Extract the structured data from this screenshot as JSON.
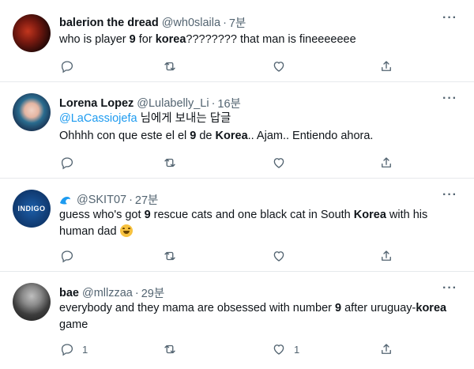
{
  "tweets": [
    {
      "name": "balerion the dread",
      "handle": "@wh0slaila",
      "time": "7분",
      "more": "···",
      "text_parts": [
        "who is player ",
        "9",
        " for ",
        "korea",
        "???????? that man is fineeeeeee"
      ],
      "reply_count": "",
      "retweet_count": "",
      "like_count": ""
    },
    {
      "name": "Lorena Lopez",
      "handle": "@Lulabelly_Li",
      "time": "16분",
      "more": "···",
      "reply_to_mention": "@LaCassiojefa",
      "reply_to_suffix": " 님에게 보내는 답글",
      "text_parts": [
        "Ohhhh con que este el el ",
        "9",
        " de ",
        "Korea",
        ".. Ajam.. Entiendo ahora."
      ],
      "reply_count": "",
      "retweet_count": "",
      "like_count": ""
    },
    {
      "name": "",
      "handle": "@SKIT07",
      "time": "27분",
      "more": "···",
      "avatar_text": "INDIGO",
      "text_parts": [
        "guess who's got ",
        "9",
        " rescue cats and one black cat in South ",
        "Korea",
        " with his human dad "
      ],
      "reply_count": "",
      "retweet_count": "",
      "like_count": ""
    },
    {
      "name": "bae",
      "handle": "@mllzzaa",
      "time": "29분",
      "more": "···",
      "text_parts": [
        "everybody and they mama are obsessed with number ",
        "9",
        " after uruguay-",
        "korea",
        " game"
      ],
      "reply_count": "1",
      "retweet_count": "",
      "like_count": "1"
    }
  ],
  "icons": {
    "reply": "reply-icon",
    "retweet": "retweet-icon",
    "like": "heart-icon",
    "share": "share-icon",
    "more": "more-icon"
  },
  "colors": {
    "link": "#1d9bf0",
    "muted": "#536471",
    "text": "#0f1419"
  }
}
